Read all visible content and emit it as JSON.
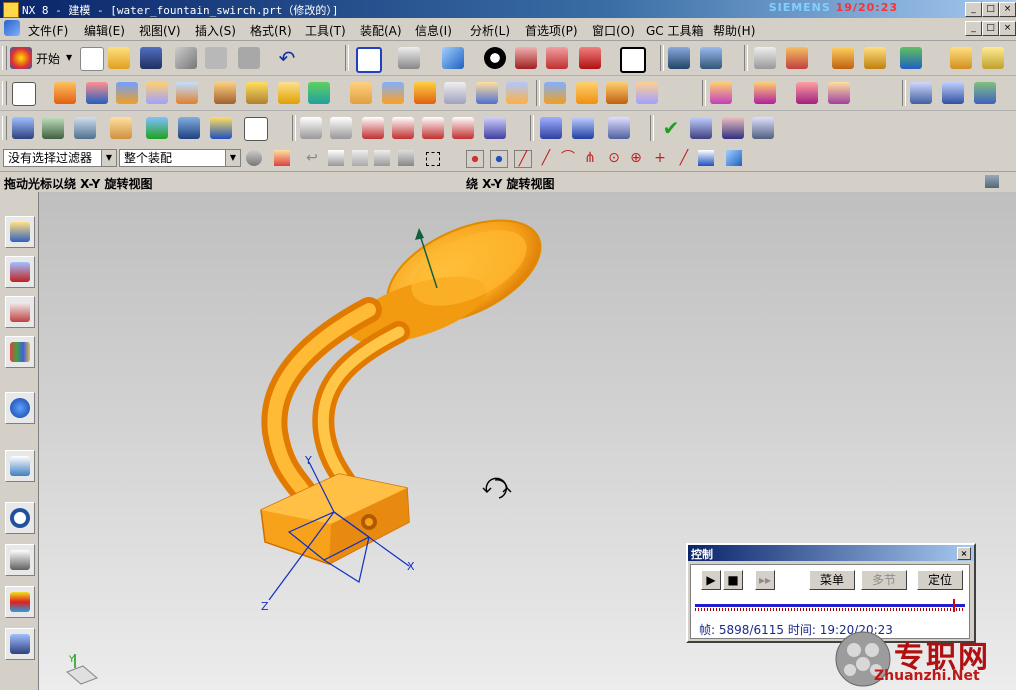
{
  "window": {
    "title": "NX 8 - 建模 - [water_fountain_swirch.prt（修改的）]",
    "brand": "SIEMENS",
    "brand_overlay": "19/20:23",
    "controls": [
      "_",
      "□",
      "×"
    ]
  },
  "menubar": {
    "items": [
      "文件(F)",
      "编辑(E)",
      "视图(V)",
      "插入(S)",
      "格式(R)",
      "工具(T)",
      "装配(A)",
      "信息(I)",
      "分析(L)",
      "首选项(P)",
      "窗口(O)",
      "GC 工具箱",
      "帮助(H)"
    ],
    "mdi_controls": [
      "_",
      "□",
      "×"
    ]
  },
  "toolbar1": {
    "start_label": "开始",
    "icons": [
      "nx-start-icon",
      "new-icon",
      "open-icon",
      "save-icon",
      "cut-icon",
      "copy-icon",
      "paste-icon",
      "undo-icon",
      "fit-view-icon",
      "display-mode-icon",
      "shaded-cube-icon",
      "render-style-icon",
      "section-view-icon",
      "orient-view-icon",
      "background-icon",
      "snap-view-icon",
      "move-object-icon",
      "layer-icon",
      "wcs-icon",
      "edit-object-icon",
      "modeling-icon",
      "study-icon",
      "measure-icon",
      "protractor-icon"
    ]
  },
  "toolbar2": {
    "icons": [
      "sketch-icon",
      "extrude-icon",
      "revolve-icon",
      "block-icon",
      "cylinder-icon",
      "cone-icon",
      "hole-icon",
      "boss-icon",
      "pocket-icon",
      "datum-plane-icon",
      "datum-axis-icon",
      "edge-blend-icon",
      "chamfer-icon",
      "shell-icon",
      "offset-face-icon",
      "unite-icon",
      "subtract-icon",
      "intersect-icon",
      "draft-icon",
      "thicken-icon",
      "sweep-icon",
      "trim-body-icon",
      "split-body-icon",
      "mirror-icon",
      "surface-icon",
      "mesh-surface-icon",
      "studio-surface-icon"
    ]
  },
  "toolbar3": {
    "icons": [
      "assembly-icon",
      "layer-settings-icon",
      "part-navigator-icon",
      "note-icon",
      "check-geometry-icon",
      "hammer-icon",
      "pmi-icon",
      "text-box-icon",
      "curve-icon",
      "g0-icon",
      "g1-icon",
      "g2-icon",
      "g3-icon",
      "analysis-icon",
      "spring-icon",
      "coil-icon",
      "gear-icon",
      "check-mark-icon",
      "tree-icon",
      "table-icon",
      "coordinate-icon"
    ]
  },
  "filterbar": {
    "filter_value": "没有选择过滤器",
    "scope_value": "整个装配",
    "icons": [
      "filter-icon",
      "select-all-icon",
      "undo-select-icon",
      "body-select-icon",
      "face-select-icon",
      "edge-select-icon",
      "rect-select-icon",
      "snap-point-icon",
      "end-point-icon",
      "mid-point-icon",
      "control-point-icon",
      "intersection-icon",
      "arc-center-icon",
      "quadrant-icon",
      "cross-icon",
      "line-icon",
      "point-on-curve-icon",
      "cube-view-icon"
    ]
  },
  "status": {
    "left_prompt": "拖动光标以绕 X-Y 旋转视图",
    "right_prompt": "绕 X-Y 旋转视图"
  },
  "resource_bar": {
    "buttons": [
      "assembly-navigator-icon",
      "constraint-navigator-icon",
      "part-navigator-icon",
      "reuse-library-icon",
      "info-icon",
      "web-browser-icon",
      "history-icon",
      "system-materials-icon",
      "roles-icon",
      "palette-icon"
    ]
  },
  "viewport": {
    "axes": {
      "x": "X",
      "y": "Y",
      "z": "Z"
    },
    "model_color": "#f8a21b",
    "rotate_cursor": "rotate-cursor-icon"
  },
  "control_panel": {
    "title": "控制",
    "close": "×",
    "play_buttons": [
      "play-icon",
      "stop-icon",
      "step-icon"
    ],
    "menu_label": "菜单",
    "step_label": "多节",
    "locate_label": "定位",
    "frame_label": "帧:",
    "frame_value": "5898/6115",
    "time_label": "时间:",
    "time_value": "19:20/20:23",
    "progress": 0.9645
  },
  "watermark": {
    "text": "专职网",
    "url": "Zhuanzhi.Net"
  }
}
